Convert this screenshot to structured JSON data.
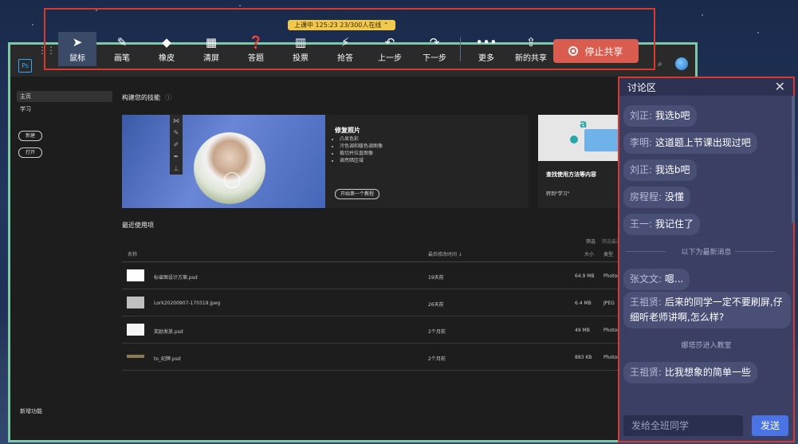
{
  "colors": {
    "toolbar_border": "#d63a2e",
    "stop_share": "#d95c4e",
    "send_button": "#4a74e6",
    "status_pill": "#f2c94c"
  },
  "toolbar": {
    "status": "上课中 125:23 23/300人在线 ⌃",
    "tools": [
      {
        "id": "mouse",
        "label": "鼠标",
        "icon": "cursor-icon"
      },
      {
        "id": "pen",
        "label": "画笔",
        "icon": "brush-icon"
      },
      {
        "id": "eraser",
        "label": "橡皮",
        "icon": "eraser-icon"
      },
      {
        "id": "clear",
        "label": "清屏",
        "icon": "clear-screen-icon"
      },
      {
        "id": "answer",
        "label": "答题",
        "icon": "question-icon"
      },
      {
        "id": "vote",
        "label": "投票",
        "icon": "vote-chart-icon"
      },
      {
        "id": "rush",
        "label": "抢答",
        "icon": "rush-answer-icon"
      },
      {
        "id": "prev",
        "label": "上一步",
        "icon": "undo-icon"
      },
      {
        "id": "next",
        "label": "下一步",
        "icon": "redo-icon"
      },
      {
        "id": "more",
        "label": "更多",
        "icon": "more-icon"
      },
      {
        "id": "new_share",
        "label": "新的共享",
        "icon": "share-upload-icon"
      }
    ],
    "stop_share_label": "停止共享"
  },
  "ps": {
    "logo": "Ps",
    "sidebar": {
      "home": "主页",
      "learn": "学习",
      "new": "新建",
      "open": "打开",
      "new_features": "新增功能"
    },
    "skills_title": "构建您的技能",
    "card1": {
      "title": "修复照片",
      "bullets": [
        "凸显色彩",
        "冷色调和暖色调图像",
        "裁切并拉直图像",
        "调亮暗区域"
      ],
      "button": "开始第一个教程"
    },
    "card2": {
      "title": "查找使用方法等内容",
      "subtitle": "转到\"学习\""
    },
    "recent_title": "最近使用项",
    "filter": "筛选",
    "filter_placeholder": "筛选最近文件",
    "table": {
      "headers": {
        "name": "名称",
        "modified": "最后修改时间 ↓",
        "size": "大小",
        "type": "类型"
      },
      "rows": [
        {
          "name": "标省图设计方案.psd",
          "modified": "19天前",
          "size": "64.9 MB",
          "type": "Photos"
        },
        {
          "name": "Lork20200907-170319.jpeg",
          "modified": "26天前",
          "size": "6.4 MB",
          "type": "JPEG"
        },
        {
          "name": "奖励发放.psd",
          "modified": "2个月前",
          "size": "49 MB",
          "type": "Photos"
        },
        {
          "name": "to_纪牌.psd",
          "modified": "2个月前",
          "size": "883 KB",
          "type": "Photos"
        }
      ]
    }
  },
  "chat": {
    "title": "讨论区",
    "messages": [
      {
        "who": "刘正:",
        "text": "我选b吧"
      },
      {
        "who": "李明:",
        "text": "这道题上节课出现过吧"
      },
      {
        "who": "刘正:",
        "text": "我选b吧"
      },
      {
        "who": "房程程:",
        "text": "没懂"
      },
      {
        "who": "王一:",
        "text": "我记住了"
      },
      {
        "who": "张文文:",
        "text": "嗯..."
      },
      {
        "who": "王祖贤:",
        "text": "后来的同学一定不要刷屏,仔细听老师讲啊,怎么样?"
      },
      {
        "who": "王祖贤:",
        "text": "比我想象的简单一些"
      }
    ],
    "system_new": "以下为最新消息",
    "system_join": "娜塔莎进入教室",
    "input_placeholder": "发给全班同学",
    "send_label": "发送"
  }
}
